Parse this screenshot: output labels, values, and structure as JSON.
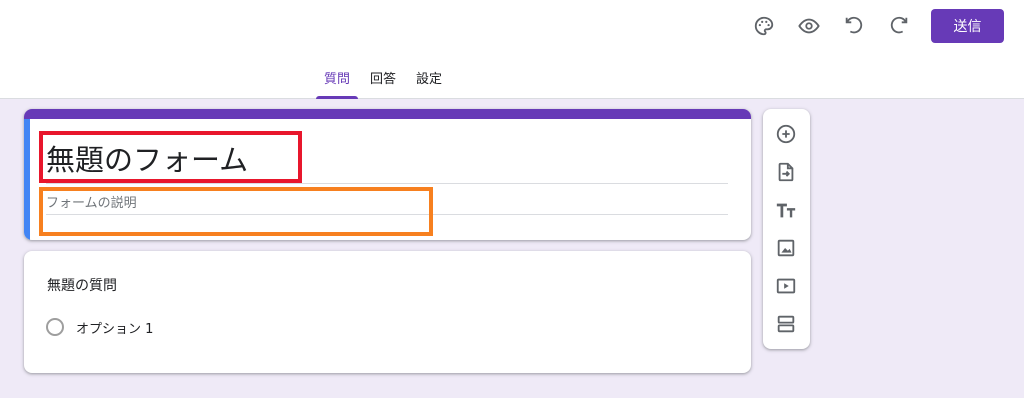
{
  "header": {
    "icons": [
      "palette-icon",
      "preview-eye-icon",
      "undo-icon",
      "redo-icon"
    ],
    "send_label": "送信",
    "tabs": [
      {
        "label": "質問",
        "active": true
      },
      {
        "label": "回答",
        "active": false
      },
      {
        "label": "設定",
        "active": false
      }
    ]
  },
  "form": {
    "title": "無題のフォーム",
    "description_placeholder": "フォームの説明"
  },
  "question": {
    "title": "無題の質問",
    "options": [
      "オプション 1"
    ]
  },
  "toolbar": {
    "tools": [
      "add-question-icon",
      "import-questions-icon",
      "add-title-icon",
      "add-image-icon",
      "add-video-icon",
      "add-section-icon"
    ]
  },
  "colors": {
    "accent": "#673ab7",
    "focus_bar": "#4285f4",
    "background": "#efeaf7",
    "highlight_red": "#e8162c",
    "highlight_orange": "#f7801f"
  }
}
